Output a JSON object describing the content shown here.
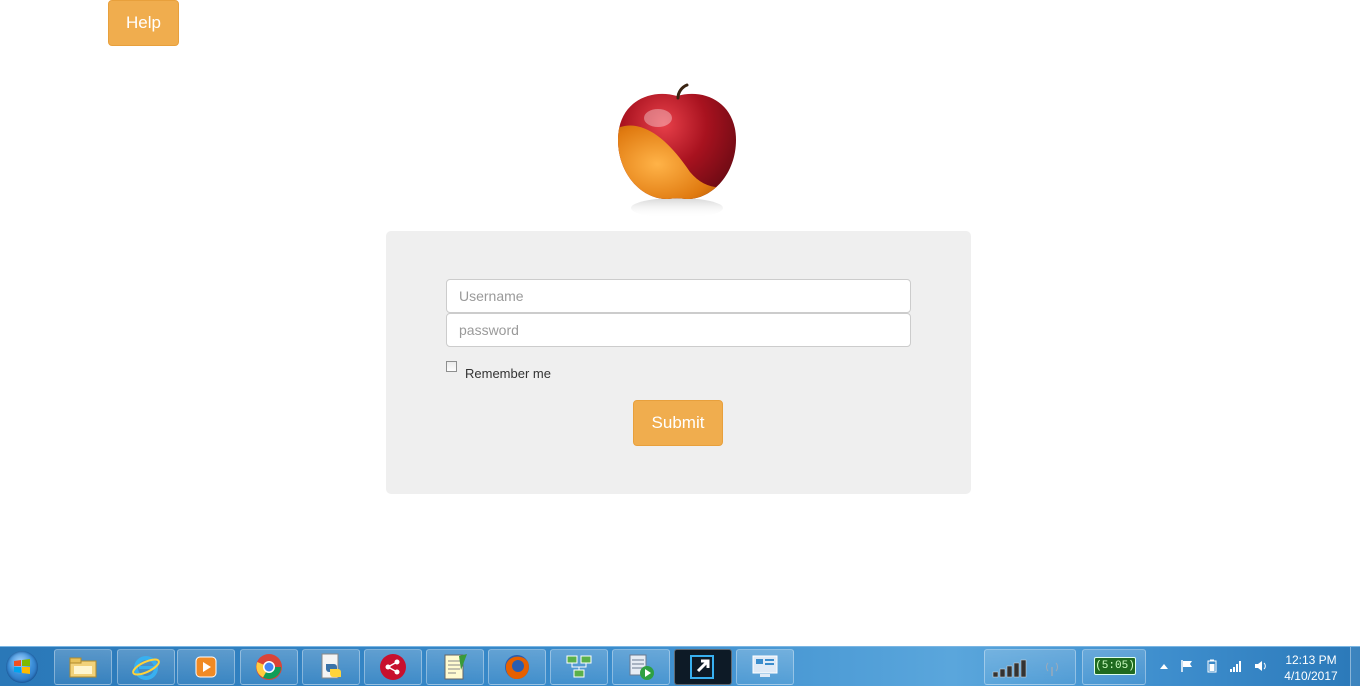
{
  "help_button": {
    "label": "Help"
  },
  "login": {
    "username_placeholder": "Username",
    "password_placeholder": "password",
    "remember_label": "Remember me",
    "submit_label": "Submit"
  },
  "colors": {
    "accent": "#f0ad4e",
    "panel_bg": "#efefef"
  },
  "taskbar": {
    "apps": [
      "file-explorer-icon",
      "internet-explorer-icon",
      "media-player-icon",
      "chrome-icon",
      "python-icon",
      "share-app-icon",
      "notepad-icon",
      "firefox-icon",
      "network-diagram-icon",
      "media-server-icon",
      "remote-shortcut-icon",
      "control-panel-icon"
    ],
    "battery_text": "(5:05)",
    "time": "12:13 PM",
    "date": "4/10/2017"
  }
}
